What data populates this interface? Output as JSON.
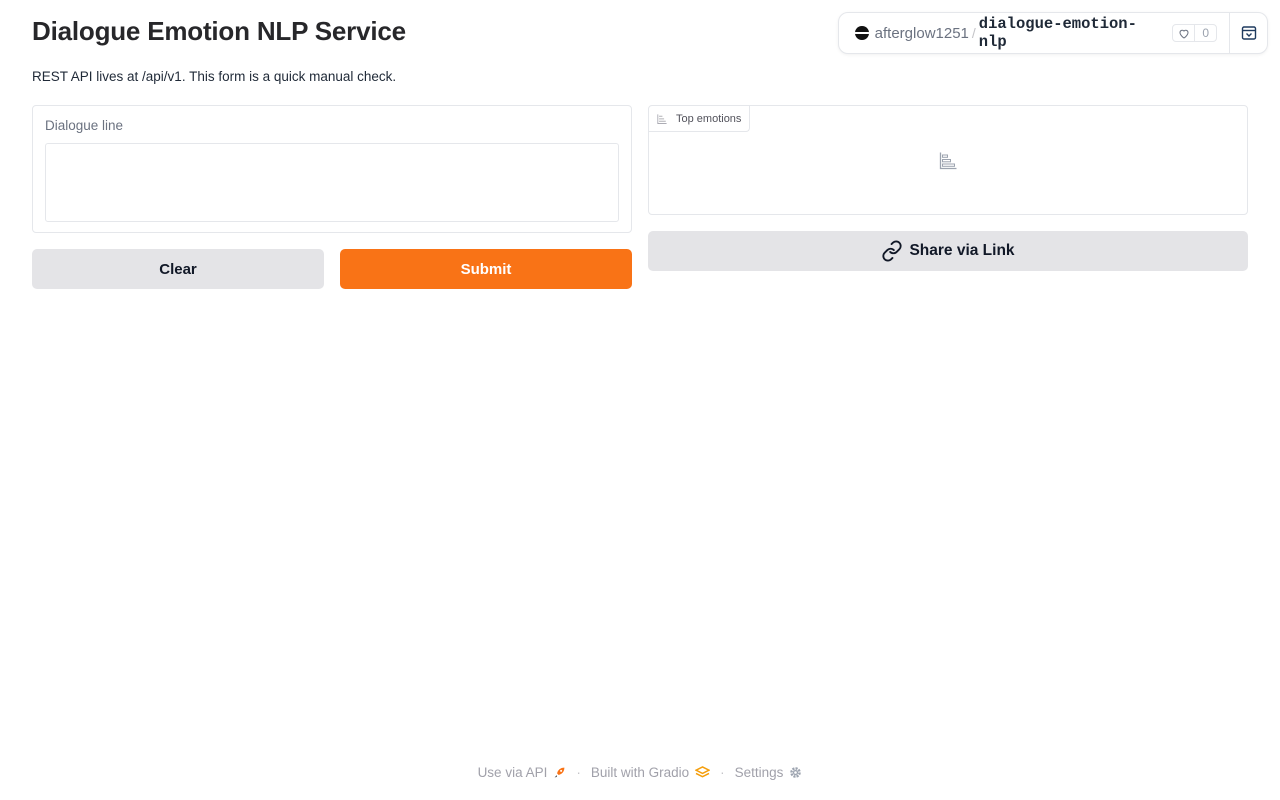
{
  "header": {
    "title": "Dialogue Emotion NLP Service",
    "description": "REST API lives at /api/v1. This form is a quick manual check."
  },
  "space_badge": {
    "owner": "afterglow1251",
    "separator": "/",
    "space_name": "dialogue-emotion-nlp",
    "likes": "0",
    "icons": [
      "owner-avatar-icon",
      "heart-icon",
      "embed-icon"
    ]
  },
  "input": {
    "label": "Dialogue line",
    "value": "",
    "placeholder": ""
  },
  "buttons": {
    "clear_label": "Clear",
    "submit_label": "Submit",
    "share_label": "Share via Link"
  },
  "output": {
    "label": "Top emotions",
    "icon": "bar-chart-icon",
    "empty_icon": "bar-chart-icon"
  },
  "footer": {
    "api_label": "Use via API",
    "built_label": "Built with Gradio",
    "settings_label": "Settings",
    "separator": "·"
  },
  "colors": {
    "accent": "#f97316",
    "secondary_button": "#e4e4e7",
    "border": "#e5e7eb"
  }
}
